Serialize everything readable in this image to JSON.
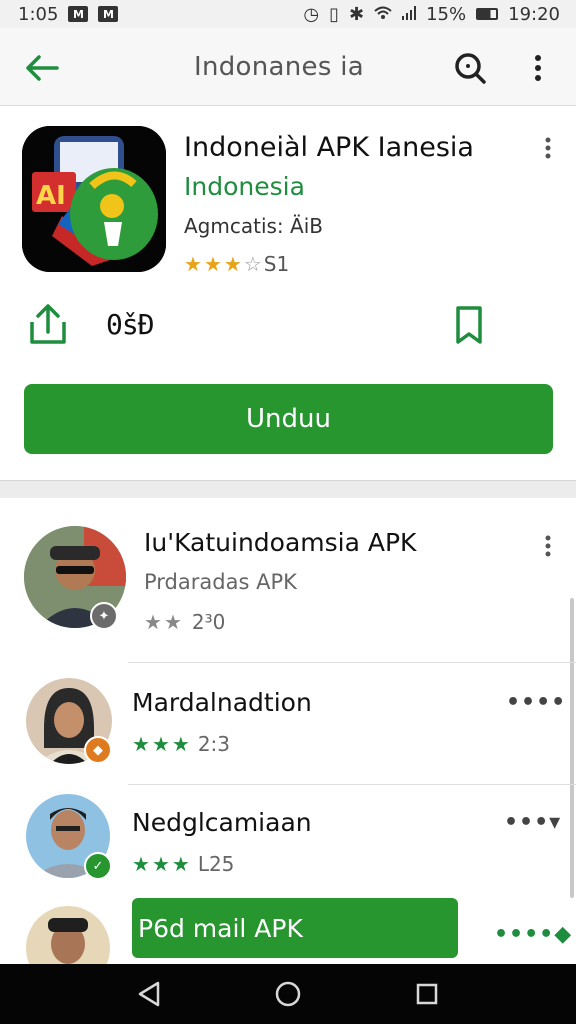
{
  "status_bar": {
    "time_left": "1:05",
    "icon_m": "M",
    "icon_box": "M",
    "battery": "15%",
    "time_right": "19:20"
  },
  "app_bar": {
    "title": "Indonanes ia",
    "back_icon": "arrow-left-icon",
    "search_icon": "search-icon",
    "more_icon": "more-vert-icon"
  },
  "app": {
    "name": "Indoneiàl APK Ianesia",
    "developer": "Indonesia",
    "category": "Agmcatis: ÄiB",
    "rating_stars": 3.5,
    "rating_text": "S1",
    "size": "0šĐ",
    "install_label": "Unduu",
    "accent_color": "#27962f"
  },
  "list": {
    "items": [
      {
        "title": "Iu'Katuindoamsia APK",
        "subtitle": "Prdaradas APK",
        "rating_stars": 2,
        "rating_text": "2³0",
        "badge_color": "#6b6b6b",
        "star_color": "grey"
      },
      {
        "title": "Mardalnadtion",
        "subtitle": "",
        "rating_stars": 3,
        "rating_text": "2:3",
        "badge_color": "#e07a1f",
        "star_color": "green"
      },
      {
        "title": "Nedglcamiaan",
        "subtitle": "",
        "rating_stars": 3,
        "rating_text": "L25",
        "badge_color": "#27962f",
        "star_color": "green"
      }
    ],
    "apk_button_label": "P6d mail APK"
  },
  "nav": {
    "back": "nav-back-icon",
    "home": "nav-home-icon",
    "recents": "nav-recents-icon"
  }
}
